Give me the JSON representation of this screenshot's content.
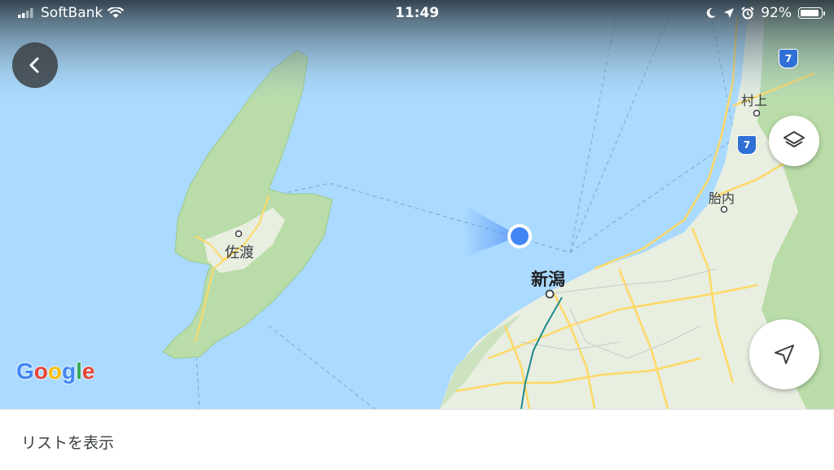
{
  "status_bar": {
    "carrier": "SoftBank",
    "time": "11:49",
    "battery_percent": "92%",
    "battery_level": 0.92
  },
  "map": {
    "places": {
      "sado": "佐渡",
      "niigata": "新潟",
      "murakami": "村上",
      "tainai": "胎内"
    },
    "route_number_1": "7",
    "route_number_2": "7",
    "colors": {
      "sea": "#aadaff",
      "land": "#e8eee0",
      "forest": "#b9dca8",
      "road": "#ffd966",
      "location_dot": "#4285f4"
    }
  },
  "branding": {
    "google_logo": [
      "G",
      "o",
      "o",
      "g",
      "l",
      "e"
    ]
  },
  "bottom_bar": {
    "label": "リストを表示"
  },
  "icons": {
    "back": "chevron-left-icon",
    "layers": "layers-icon",
    "locate": "navigation-arrow-icon"
  }
}
